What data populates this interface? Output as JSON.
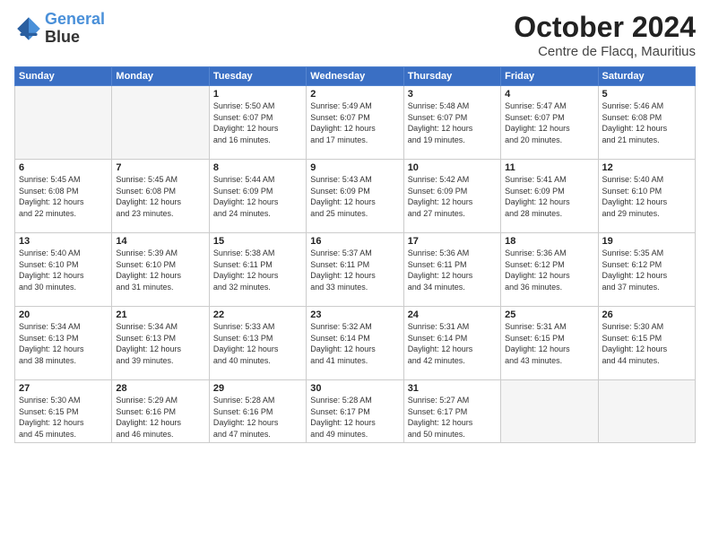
{
  "logo": {
    "line1": "General",
    "line2": "Blue"
  },
  "header": {
    "month": "October 2024",
    "location": "Centre de Flacq, Mauritius"
  },
  "weekdays": [
    "Sunday",
    "Monday",
    "Tuesday",
    "Wednesday",
    "Thursday",
    "Friday",
    "Saturday"
  ],
  "weeks": [
    [
      {
        "day": "",
        "empty": true
      },
      {
        "day": "",
        "empty": true
      },
      {
        "day": "1",
        "sunrise": "5:50 AM",
        "sunset": "6:07 PM",
        "daylight": "12 hours and 16 minutes."
      },
      {
        "day": "2",
        "sunrise": "5:49 AM",
        "sunset": "6:07 PM",
        "daylight": "12 hours and 17 minutes."
      },
      {
        "day": "3",
        "sunrise": "5:48 AM",
        "sunset": "6:07 PM",
        "daylight": "12 hours and 19 minutes."
      },
      {
        "day": "4",
        "sunrise": "5:47 AM",
        "sunset": "6:07 PM",
        "daylight": "12 hours and 20 minutes."
      },
      {
        "day": "5",
        "sunrise": "5:46 AM",
        "sunset": "6:08 PM",
        "daylight": "12 hours and 21 minutes."
      }
    ],
    [
      {
        "day": "6",
        "sunrise": "5:45 AM",
        "sunset": "6:08 PM",
        "daylight": "12 hours and 22 minutes."
      },
      {
        "day": "7",
        "sunrise": "5:45 AM",
        "sunset": "6:08 PM",
        "daylight": "12 hours and 23 minutes."
      },
      {
        "day": "8",
        "sunrise": "5:44 AM",
        "sunset": "6:09 PM",
        "daylight": "12 hours and 24 minutes."
      },
      {
        "day": "9",
        "sunrise": "5:43 AM",
        "sunset": "6:09 PM",
        "daylight": "12 hours and 25 minutes."
      },
      {
        "day": "10",
        "sunrise": "5:42 AM",
        "sunset": "6:09 PM",
        "daylight": "12 hours and 27 minutes."
      },
      {
        "day": "11",
        "sunrise": "5:41 AM",
        "sunset": "6:09 PM",
        "daylight": "12 hours and 28 minutes."
      },
      {
        "day": "12",
        "sunrise": "5:40 AM",
        "sunset": "6:10 PM",
        "daylight": "12 hours and 29 minutes."
      }
    ],
    [
      {
        "day": "13",
        "sunrise": "5:40 AM",
        "sunset": "6:10 PM",
        "daylight": "12 hours and 30 minutes."
      },
      {
        "day": "14",
        "sunrise": "5:39 AM",
        "sunset": "6:10 PM",
        "daylight": "12 hours and 31 minutes."
      },
      {
        "day": "15",
        "sunrise": "5:38 AM",
        "sunset": "6:11 PM",
        "daylight": "12 hours and 32 minutes."
      },
      {
        "day": "16",
        "sunrise": "5:37 AM",
        "sunset": "6:11 PM",
        "daylight": "12 hours and 33 minutes."
      },
      {
        "day": "17",
        "sunrise": "5:36 AM",
        "sunset": "6:11 PM",
        "daylight": "12 hours and 34 minutes."
      },
      {
        "day": "18",
        "sunrise": "5:36 AM",
        "sunset": "6:12 PM",
        "daylight": "12 hours and 36 minutes."
      },
      {
        "day": "19",
        "sunrise": "5:35 AM",
        "sunset": "6:12 PM",
        "daylight": "12 hours and 37 minutes."
      }
    ],
    [
      {
        "day": "20",
        "sunrise": "5:34 AM",
        "sunset": "6:13 PM",
        "daylight": "12 hours and 38 minutes."
      },
      {
        "day": "21",
        "sunrise": "5:34 AM",
        "sunset": "6:13 PM",
        "daylight": "12 hours and 39 minutes."
      },
      {
        "day": "22",
        "sunrise": "5:33 AM",
        "sunset": "6:13 PM",
        "daylight": "12 hours and 40 minutes."
      },
      {
        "day": "23",
        "sunrise": "5:32 AM",
        "sunset": "6:14 PM",
        "daylight": "12 hours and 41 minutes."
      },
      {
        "day": "24",
        "sunrise": "5:31 AM",
        "sunset": "6:14 PM",
        "daylight": "12 hours and 42 minutes."
      },
      {
        "day": "25",
        "sunrise": "5:31 AM",
        "sunset": "6:15 PM",
        "daylight": "12 hours and 43 minutes."
      },
      {
        "day": "26",
        "sunrise": "5:30 AM",
        "sunset": "6:15 PM",
        "daylight": "12 hours and 44 minutes."
      }
    ],
    [
      {
        "day": "27",
        "sunrise": "5:30 AM",
        "sunset": "6:15 PM",
        "daylight": "12 hours and 45 minutes."
      },
      {
        "day": "28",
        "sunrise": "5:29 AM",
        "sunset": "6:16 PM",
        "daylight": "12 hours and 46 minutes."
      },
      {
        "day": "29",
        "sunrise": "5:28 AM",
        "sunset": "6:16 PM",
        "daylight": "12 hours and 47 minutes."
      },
      {
        "day": "30",
        "sunrise": "5:28 AM",
        "sunset": "6:17 PM",
        "daylight": "12 hours and 49 minutes."
      },
      {
        "day": "31",
        "sunrise": "5:27 AM",
        "sunset": "6:17 PM",
        "daylight": "12 hours and 50 minutes."
      },
      {
        "day": "",
        "empty": true
      },
      {
        "day": "",
        "empty": true
      }
    ]
  ],
  "labels": {
    "sunrise": "Sunrise:",
    "sunset": "Sunset:",
    "daylight": "Daylight:"
  }
}
